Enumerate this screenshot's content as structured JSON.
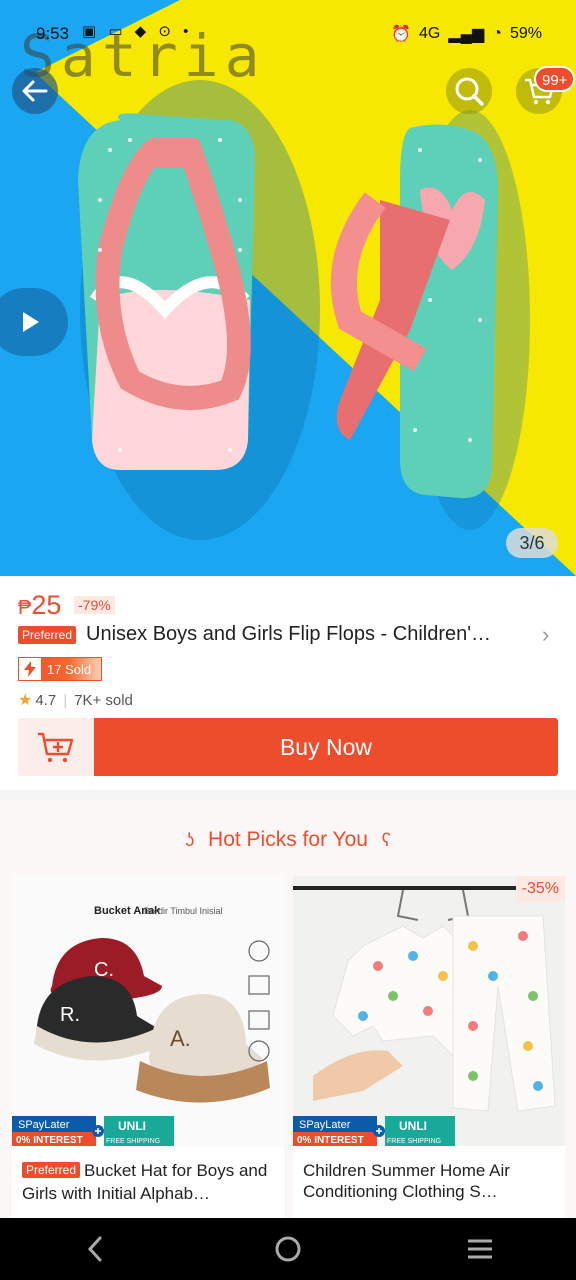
{
  "status_bar": {
    "time": "9:53",
    "battery": "59%",
    "network": "4G"
  },
  "watermark": "Satria",
  "header": {
    "cart_badge": "99+"
  },
  "gallery": {
    "page_indicator": "3/6"
  },
  "product": {
    "currency": "₱",
    "price": "25",
    "discount": "-79%",
    "preferred_label": "Preferred",
    "title": "Unisex Boys and Girls Flip Flops - Children'…",
    "sold_badge": "17 Sold",
    "rating": "4.7",
    "sold_count": "7K+ sold",
    "buy_now_label": "Buy Now"
  },
  "hot_picks": {
    "title": "Hot Picks for You",
    "items": [
      {
        "preferred_label": "Preferred",
        "title": "Bucket Hat for Boys and Girls with Initial Alphab…",
        "image_text": "Bucket Anak",
        "image_subtext": "Bordir Timbul Inisial",
        "spaylater": "SPayLater",
        "interest": "0% INTEREST",
        "unli": "UNLI",
        "free_shipping": "FREE SHIPPING"
      },
      {
        "discount": "-35%",
        "title": "Children Summer Home Air Conditioning Clothing S…",
        "spaylater": "SPayLater",
        "interest": "0% INTEREST",
        "unli": "UNLI",
        "free_shipping": "FREE SHIPPING"
      }
    ]
  },
  "colors": {
    "brand": "#ee4d2d",
    "hero_yellow": "#f6e800",
    "hero_blue": "#1aa6f0"
  }
}
